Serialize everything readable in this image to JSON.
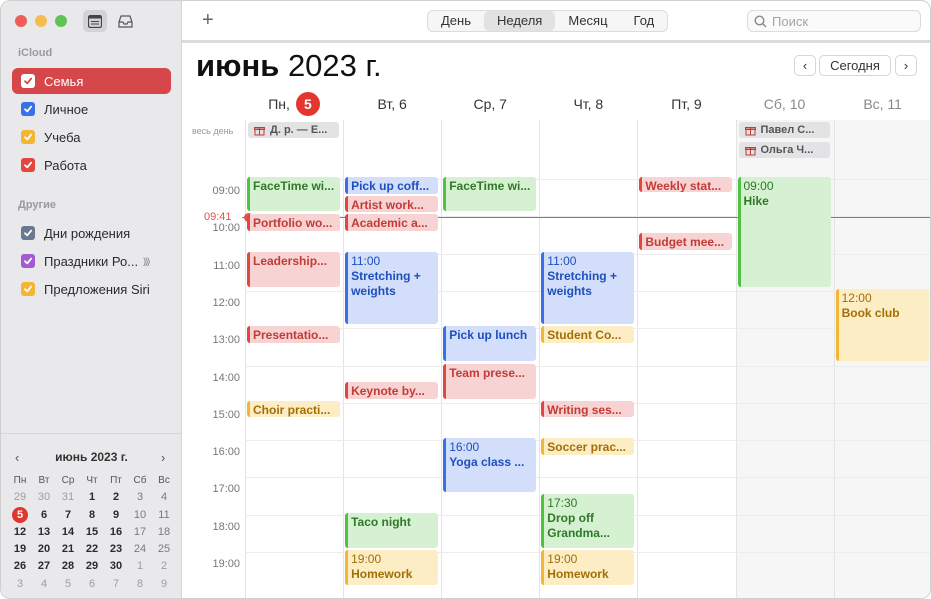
{
  "sidebar": {
    "icloud_label": "iCloud",
    "others_label": "Другие",
    "calendars": [
      {
        "label": "Семья",
        "color": "#d5474b"
      },
      {
        "label": "Личное",
        "color": "#3a70e6"
      },
      {
        "label": "Учеба",
        "color": "#f2b633"
      },
      {
        "label": "Работа",
        "color": "#e1463f"
      }
    ],
    "others": [
      {
        "label": "Дни рождения",
        "color": "#6b7892"
      },
      {
        "label": "Праздники Ро...",
        "color": "#a35bd4"
      },
      {
        "label": "Предложения Siri",
        "color": "#f2b633"
      }
    ]
  },
  "mini_cal": {
    "title": "июнь 2023 г.",
    "prev": "‹",
    "next": "›",
    "dows": [
      "Пн",
      "Вт",
      "Ср",
      "Чт",
      "Пт",
      "Сб",
      "Вс"
    ],
    "weeks": [
      [
        "29",
        "30",
        "31",
        "1",
        "2",
        "3",
        "4"
      ],
      [
        "5",
        "6",
        "7",
        "8",
        "9",
        "10",
        "11"
      ],
      [
        "12",
        "13",
        "14",
        "15",
        "16",
        "17",
        "18"
      ],
      [
        "19",
        "20",
        "21",
        "22",
        "23",
        "24",
        "25"
      ],
      [
        "26",
        "27",
        "28",
        "29",
        "30",
        "1",
        "2"
      ],
      [
        "3",
        "4",
        "5",
        "6",
        "7",
        "8",
        "9"
      ]
    ]
  },
  "toolbar": {
    "add": "+",
    "views": [
      "День",
      "Неделя",
      "Месяц",
      "Год"
    ],
    "active_view": "Неделя",
    "search_placeholder": "Поиск"
  },
  "header": {
    "month": "июнь",
    "year": "2023 г.",
    "today_btn": "Сегодня",
    "prev": "‹",
    "next": "›"
  },
  "days": [
    {
      "label": "Пн,",
      "num": "5",
      "today": true
    },
    {
      "label": "Вт, 6"
    },
    {
      "label": "Ср, 7"
    },
    {
      "label": "Чт, 8"
    },
    {
      "label": "Пт, 9"
    },
    {
      "label": "Сб, 10",
      "weekend": true
    },
    {
      "label": "Вс, 11",
      "weekend": true
    }
  ],
  "allday_label": "весь день",
  "allday_events": [
    {
      "day": 0,
      "row": 0,
      "title": "Д. р. — Е..."
    },
    {
      "day": 5,
      "row": 0,
      "title": "Павел С..."
    },
    {
      "day": 5,
      "row": 1,
      "title": "Ольга Ч..."
    }
  ],
  "hours": [
    "09:00",
    "10:00",
    "11:00",
    "12:00",
    "13:00",
    "14:00",
    "15:00",
    "16:00",
    "17:00",
    "18:00",
    "19:00"
  ],
  "now_label": "09:41",
  "events": [
    {
      "day": 0,
      "start": 9.0,
      "end": 9.97,
      "title": "FaceTime wi...",
      "color": "green"
    },
    {
      "day": 0,
      "start": 10.0,
      "end": 10.5,
      "title": "Portfolio wo...",
      "color": "red"
    },
    {
      "day": 0,
      "start": 11.0,
      "end": 12.0,
      "title": "Leadership...",
      "color": "red"
    },
    {
      "day": 0,
      "start": 13.0,
      "end": 13.5,
      "title": "Presentatio...",
      "color": "red"
    },
    {
      "day": 0,
      "start": 15.0,
      "end": 15.5,
      "title": "Choir practi...",
      "color": "yellow"
    },
    {
      "day": 1,
      "start": 9.0,
      "end": 9.5,
      "title": "Pick up coff...",
      "color": "blue"
    },
    {
      "day": 1,
      "start": 9.5,
      "end": 10.0,
      "title": "Artist work...",
      "color": "red"
    },
    {
      "day": 1,
      "start": 10.0,
      "end": 10.5,
      "title": "Academic a...",
      "color": "red"
    },
    {
      "day": 1,
      "start": 11.0,
      "end": 13.0,
      "time": "11:00",
      "title": "Stretching + weights",
      "color": "blue",
      "wrap": true
    },
    {
      "day": 1,
      "start": 14.5,
      "end": 15.0,
      "title": "Keynote by...",
      "color": "red"
    },
    {
      "day": 1,
      "start": 18.0,
      "end": 19.0,
      "title": "Taco night",
      "color": "green"
    },
    {
      "day": 1,
      "start": 19.0,
      "end": 20.0,
      "time": "19:00",
      "title": "Homework",
      "color": "yellow"
    },
    {
      "day": 2,
      "start": 9.0,
      "end": 9.97,
      "title": "FaceTime wi...",
      "color": "green"
    },
    {
      "day": 2,
      "start": 13.0,
      "end": 14.0,
      "title": "Pick up lunch",
      "color": "blue"
    },
    {
      "day": 2,
      "start": 14.0,
      "end": 15.0,
      "title": "Team prese...",
      "color": "red"
    },
    {
      "day": 2,
      "start": 16.0,
      "end": 17.5,
      "time": "16:00",
      "title": "Yoga class ...",
      "color": "blue"
    },
    {
      "day": 3,
      "start": 11.0,
      "end": 13.0,
      "time": "11:00",
      "title": "Stretching + weights",
      "color": "blue",
      "wrap": true
    },
    {
      "day": 3,
      "start": 13.0,
      "end": 13.5,
      "title": "Student Co...",
      "color": "yellow"
    },
    {
      "day": 3,
      "start": 15.0,
      "end": 15.5,
      "title": "Writing ses...",
      "color": "red"
    },
    {
      "day": 3,
      "start": 16.0,
      "end": 16.5,
      "title": "Soccer prac...",
      "color": "yellow"
    },
    {
      "day": 3,
      "start": 17.5,
      "end": 19.0,
      "time": "17:30",
      "title": "Drop off Grandma...",
      "color": "green",
      "wrap": true
    },
    {
      "day": 3,
      "start": 19.0,
      "end": 20.0,
      "time": "19:00",
      "title": "Homework",
      "color": "yellow"
    },
    {
      "day": 4,
      "start": 9.0,
      "end": 9.4,
      "title": "Weekly stat...",
      "color": "red"
    },
    {
      "day": 4,
      "start": 10.5,
      "end": 11.0,
      "title": "Budget mee...",
      "color": "red"
    },
    {
      "day": 5,
      "start": 9.0,
      "end": 12.0,
      "time": "09:00",
      "title": "Hike",
      "color": "green"
    },
    {
      "day": 6,
      "start": 12.0,
      "end": 14.0,
      "time": "12:00",
      "title": "Book club",
      "color": "yellow"
    }
  ]
}
